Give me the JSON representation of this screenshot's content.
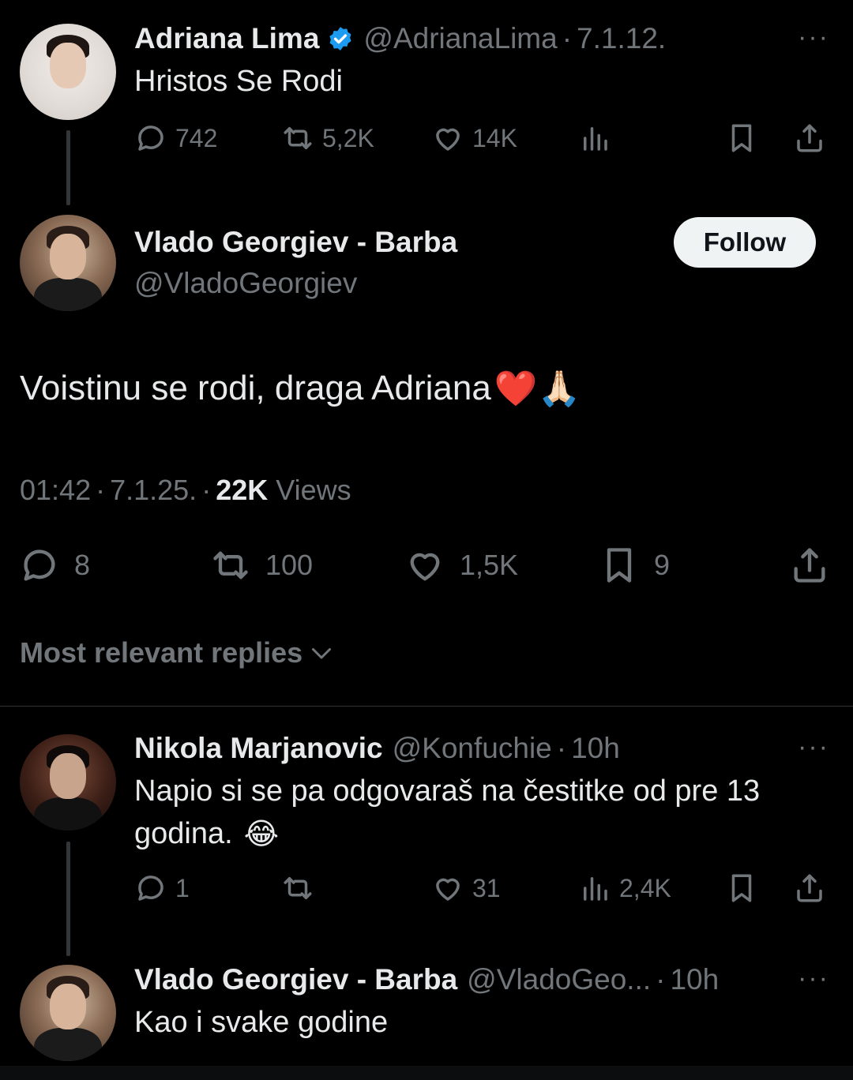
{
  "tweet1": {
    "name": "Adriana Lima",
    "handle": "@AdrianaLima",
    "date": "7.1.12.",
    "text": "Hristos Se Rodi",
    "replies": "742",
    "reposts": "5,2K",
    "likes": "14K",
    "more": "···"
  },
  "main": {
    "name": "Vlado Georgiev - Barba",
    "handle": "@VladoGeorgiev",
    "follow_label": "Follow",
    "text": "Voistinu se rodi, draga Adriana",
    "emoji": "❤️🙏🏻",
    "time": "01:42",
    "date": "7.1.25.",
    "views_count": "22K",
    "views_label": "Views",
    "replies": "8",
    "reposts": "100",
    "likes": "1,5K",
    "bookmarks": "9"
  },
  "sort": {
    "label": "Most relevant replies"
  },
  "reply1": {
    "name": "Nikola Marjanovic",
    "handle": "@Konfuchie",
    "time": "10h",
    "text_line1": "Napio si se pa odgovaraš na čestitke od pre 13",
    "text_line2": "godina.",
    "emoji": "😂",
    "replies": "1",
    "likes": "31",
    "views": "2,4K",
    "more": "···"
  },
  "reply2": {
    "name": "Vlado Georgiev - Barba",
    "handle": "@VladoGeo...",
    "time": "10h",
    "text": "Kao i svake godine",
    "more": "···"
  },
  "colors": {
    "background": "#000000",
    "text": "#e7e9ea",
    "muted": "#71767b",
    "verified": "#1d9bf0",
    "follow_bg": "#eff3f4"
  }
}
